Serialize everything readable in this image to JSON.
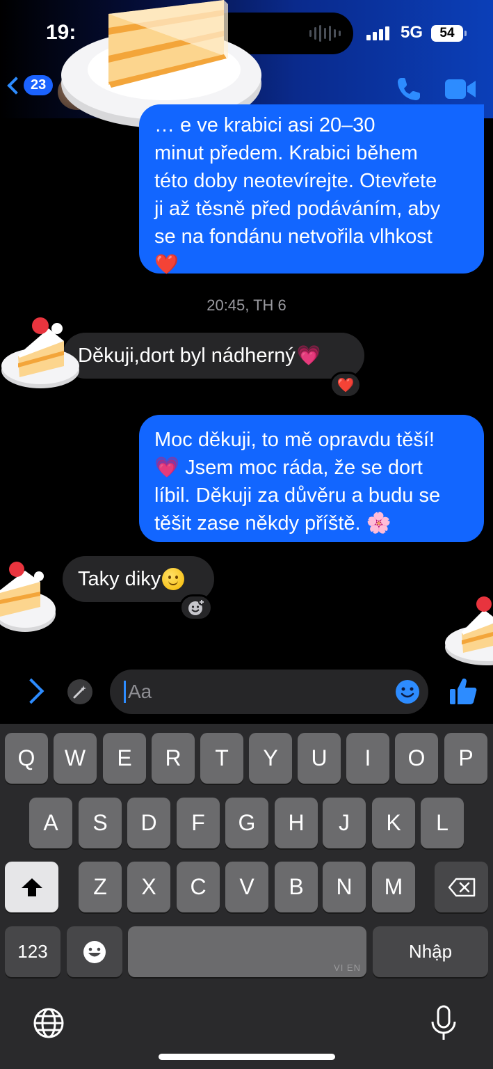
{
  "status_bar": {
    "time": "19:",
    "network": "5G",
    "battery": "54"
  },
  "header": {
    "back_count": "23",
    "icons": [
      "chevron-left-icon",
      "phone-icon",
      "video-camera-icon"
    ]
  },
  "messages": [
    {
      "direction": "out",
      "lines": [
        "… e ve krabici asi 20–30",
        "minut předem. Krabici během",
        "této doby neotevírejte. Otevřete",
        "ji až těsně před podáváním, aby",
        "se na fondánu netvořila vlhkost"
      ],
      "emoji": "❤️"
    },
    {
      "timestamp": "20:45, TH 6"
    },
    {
      "direction": "in",
      "text": "Děkuji,dort byl nádherný",
      "emoji": "💗",
      "reaction": "❤️"
    },
    {
      "direction": "out",
      "lines": [
        "Moc děkuji, to mě opravdu těší!",
        "💗 Jsem moc ráda, že se dort",
        "líbil. Děkuji za důvěru a budu se",
        "těšit zase někdy příště. 🌸"
      ]
    },
    {
      "direction": "in",
      "text": "Taky diky",
      "emoji": "slightly-smiling-face",
      "reaction": "add-reaction-icon"
    }
  ],
  "composer": {
    "placeholder": "Aa"
  },
  "keyboard": {
    "row1": [
      "Q",
      "W",
      "E",
      "R",
      "T",
      "Y",
      "U",
      "I",
      "O",
      "P"
    ],
    "row2": [
      "A",
      "S",
      "D",
      "F",
      "G",
      "H",
      "J",
      "K",
      "L"
    ],
    "row3": [
      "Z",
      "X",
      "C",
      "V",
      "B",
      "N",
      "M"
    ],
    "numbers_key": "123",
    "return_key": "Nhập",
    "space_hint": "VI EN"
  },
  "colors": {
    "outgoing_bubble": "#1266ff",
    "incoming_bubble": "#262628",
    "accent": "#2d8cff"
  }
}
